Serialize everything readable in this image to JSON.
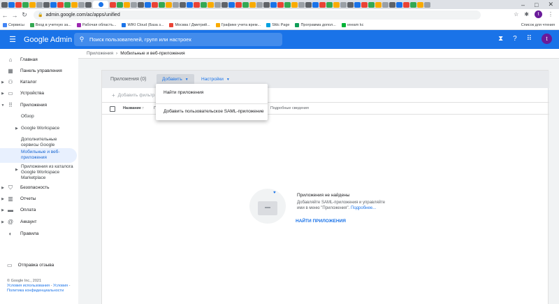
{
  "browser": {
    "url": "admin.google.com/ac/apps/unified",
    "profile_initial": "t",
    "bookmarks": [
      {
        "label": "Сервисы",
        "color": "#4285f4"
      },
      {
        "label": "Вход в учетную за...",
        "color": "#34a853"
      },
      {
        "label": "Рабочая областъ...",
        "color": "#9c27b0"
      },
      {
        "label": "WIKI Cloud (База з...",
        "color": "#1a73e8"
      },
      {
        "label": "Москва / Дмитрий...",
        "color": "#ea4335"
      },
      {
        "label": "Графике учета врем...",
        "color": "#f9ab00"
      },
      {
        "label": "Sfdc Page",
        "color": "#00a1e0"
      },
      {
        "label": "Программа допол...",
        "color": "#0f9d58"
      },
      {
        "label": "veeam kc",
        "color": "#00b336"
      }
    ],
    "bookmarks_right": "Список для чтения"
  },
  "appbar": {
    "brand": "Google Admin",
    "search_placeholder": "Поиск пользователей, групп или настроек"
  },
  "breadcrumb": {
    "parent": "Приложения",
    "current": "Мобильные и веб-приложения"
  },
  "sidebar": {
    "home": "Главная",
    "dashboard": "Панель управления",
    "catalog": "Каталог",
    "devices": "Устройства",
    "apps": "Приложения",
    "overview": "Обзор",
    "workspace": "Google Workspace",
    "additional": "Дополнительные сервисы Google",
    "web_mobile": "Мобильные и веб-приложения",
    "marketplace": "Приложения из каталога Google Workspace Marketplace",
    "security": "Безопасность",
    "reports": "Отчеты",
    "billing": "Оплата",
    "account": "Аккаунт",
    "rules": "Правила",
    "feedback": "Отправка отзыва",
    "copyright": "© Google Inc., 2021",
    "terms": "Условия использования",
    "terms_sep": " - ",
    "terms2": "Условия",
    "privacy_sep": " - ",
    "privacy": "Политика конфиденциальности"
  },
  "card": {
    "count_label": "Приложения (0)",
    "add_label": "Добавить",
    "settings_label": "Настройки",
    "filter_label": "Добавить фильтр",
    "col_name": "Название",
    "col_p": "П",
    "col_details": "Подробные сведения"
  },
  "menu": {
    "find": "Найти приложения",
    "add_saml": "Добавить пользовательское SAML-приложение"
  },
  "empty": {
    "title": "Приложения не найдены",
    "text": "Добавляйте SAML-приложения и управляйте ими в меню \"Приложения\". ",
    "link": "Подробнее...",
    "button": "НАЙТИ ПРИЛОЖЕНИЯ"
  }
}
